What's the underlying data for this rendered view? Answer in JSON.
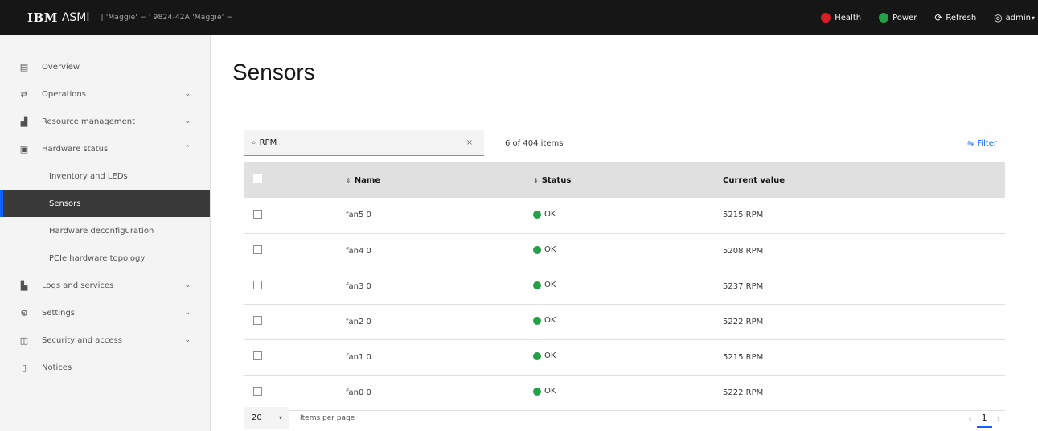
{
  "topbar": {
    "logo": "IBM",
    "app_name": "ASMI",
    "meta": "| 'Maggie' ~ '  9824-42A  'Maggie' ~",
    "health_label": "Health",
    "health_color": "#da1e28",
    "power_label": "Power",
    "power_color": "#24a148",
    "refresh_label": "Refresh",
    "user_label": "admin"
  },
  "sidebar": {
    "items": [
      {
        "label": "Overview",
        "icon": "overview-icon"
      },
      {
        "label": "Operations",
        "icon": "operations-icon"
      },
      {
        "label": "Resource management",
        "icon": "resource-icon"
      },
      {
        "label": "Hardware status",
        "icon": "hardware-icon"
      }
    ],
    "sub_items": [
      {
        "label": "Inventory and LEDs"
      },
      {
        "label": "Sensors"
      },
      {
        "label": "Hardware deconfiguration"
      },
      {
        "label": "PCIe hardware topology"
      }
    ],
    "items_after": [
      {
        "label": "Logs and services",
        "icon": "logs-icon"
      },
      {
        "label": "Settings",
        "icon": "settings-icon"
      },
      {
        "label": "Security and access",
        "icon": "security-icon"
      },
      {
        "label": "Notices",
        "icon": "notices-icon"
      }
    ]
  },
  "main": {
    "title": "Sensors",
    "search_value": "RPM",
    "item_count": "6 of 404 items",
    "filter_label": "Filter",
    "columns": [
      "Name",
      "Status",
      "Current value"
    ],
    "rows": [
      {
        "name": "fan5 0",
        "status": "OK",
        "value": "5215 RPM"
      },
      {
        "name": "fan4 0",
        "status": "OK",
        "value": "5208 RPM"
      },
      {
        "name": "fan3 0",
        "status": "OK",
        "value": "5237 RPM"
      },
      {
        "name": "fan2 0",
        "status": "OK",
        "value": "5222 RPM"
      },
      {
        "name": "fan1 0",
        "status": "OK",
        "value": "5215 RPM"
      },
      {
        "name": "fan0 0",
        "status": "OK",
        "value": "5222 RPM"
      }
    ],
    "per_page": "20",
    "per_page_label": "Items per page",
    "current_page": "1",
    "status_color": "#24a148"
  }
}
